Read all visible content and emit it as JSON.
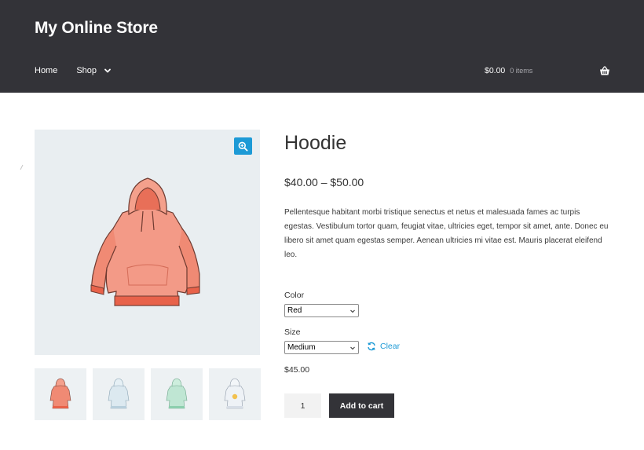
{
  "header": {
    "site_title": "My Online Store",
    "nav": [
      {
        "label": "Home"
      },
      {
        "label": "Shop"
      }
    ],
    "cart_amount": "$0.00",
    "cart_count": "0 items"
  },
  "product": {
    "title": "Hoodie",
    "price_range": "$40.00 – $50.00",
    "description": "Pellentesque habitant morbi tristique senectus et netus et malesuada fames ac turpis egestas. Vestibulum tortor quam, feugiat vitae, ultricies eget, tempor sit amet, ante. Donec eu libero sit amet quam egestas semper. Aenean ultricies mi vitae est. Mauris placerat eleifend leo.",
    "color_label": "Color",
    "color_value": "Red",
    "size_label": "Size",
    "size_value": "Medium",
    "clear_label": "Clear",
    "variation_price": "$45.00",
    "quantity": "1",
    "add_to_cart_label": "Add to cart"
  },
  "gallery": {
    "thumbnails": [
      {
        "color": "#f08a74",
        "accent": "#e8624a"
      },
      {
        "color": "#cfe0ea",
        "accent": "#9fbccc"
      },
      {
        "color": "#bfe6d3",
        "accent": "#8ccfae"
      },
      {
        "color": "#e6ebf1",
        "accent": "#b3bccb"
      }
    ]
  },
  "colors": {
    "header_bg": "#333338",
    "accent": "#1d9ad6",
    "button_bg": "#333338"
  }
}
